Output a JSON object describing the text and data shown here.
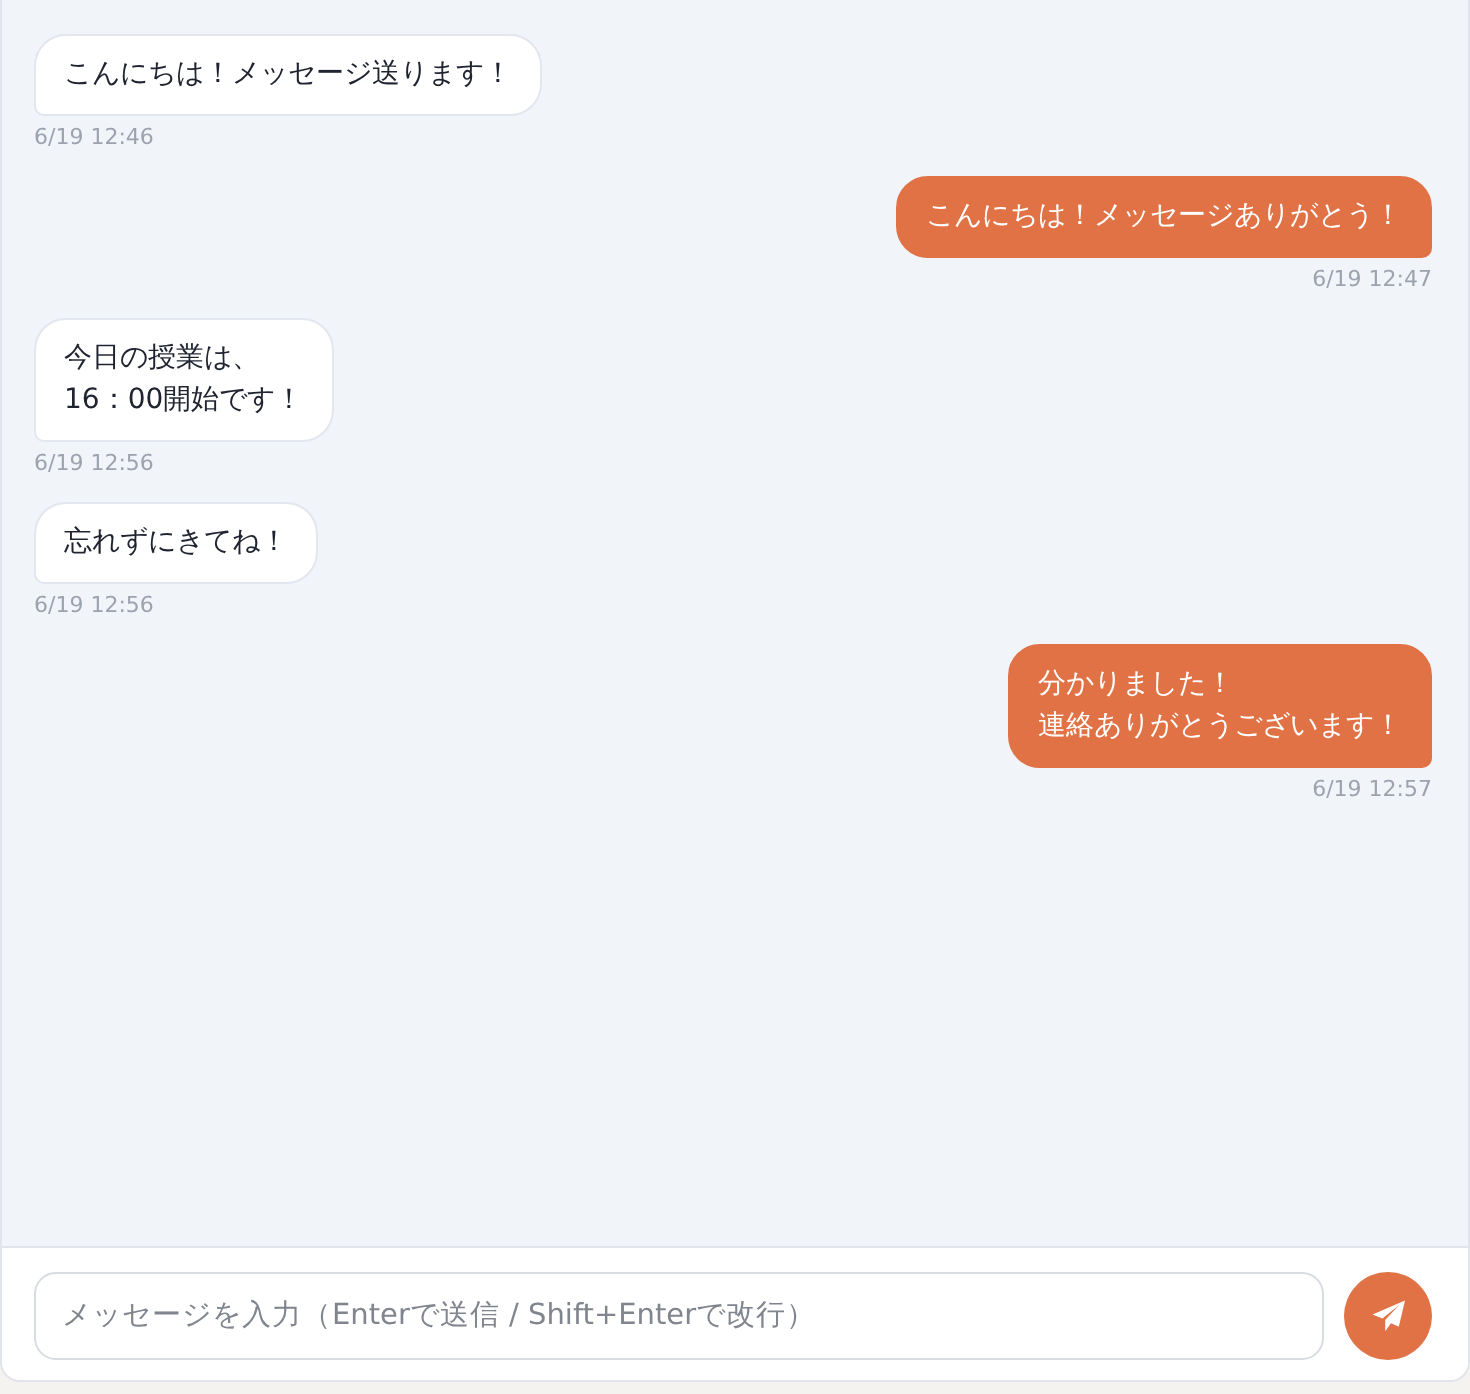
{
  "messages": [
    {
      "kind": "received",
      "lines": [
        "こんにちは！メッセージ送ります！"
      ],
      "time": "6/19 12:46"
    },
    {
      "kind": "sent",
      "lines": [
        "こんにちは！メッセージありがとう！"
      ],
      "time": "6/19 12:47"
    },
    {
      "kind": "received",
      "lines": [
        "今日の授業は、",
        "16：00開始です！"
      ],
      "time": "6/19 12:56"
    },
    {
      "kind": "received",
      "lines": [
        "忘れずにきてね！"
      ],
      "time": "6/19 12:56"
    },
    {
      "kind": "sent",
      "lines": [
        "分かりました！",
        "連絡ありがとうございます！"
      ],
      "time": "6/19 12:57"
    }
  ],
  "composer": {
    "placeholder": "メッセージを入力（Enterで送信 / Shift+Enterで改行）"
  }
}
